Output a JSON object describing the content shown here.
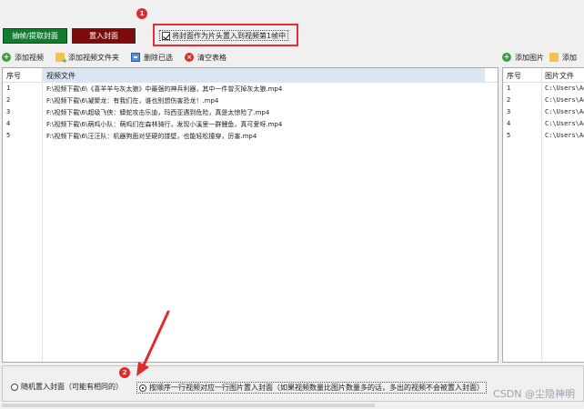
{
  "mode_buttons": {
    "extract_label": "抽帧/提取封面",
    "insert_label": "置入封面"
  },
  "annotations": {
    "badge_1": "1",
    "badge_2": "2"
  },
  "cover_option": {
    "label": "将封面作为片头置入到视频第1帧中",
    "checked": true
  },
  "left_toolbar": {
    "add_video": "添加视频",
    "add_video_folder": "添加视频文件夹",
    "delete_selected": "删除已选",
    "clear_table": "清空表格"
  },
  "right_toolbar": {
    "add_image": "添加图片",
    "add_cut": "添加"
  },
  "video_table": {
    "headers": [
      "序号",
      "视频文件"
    ],
    "rows": [
      {
        "idx": "1",
        "file": "F:\\视频下载\\6\\《喜羊羊与灰太狼》中最强的神兵利器，其中一件曾灭掉灰太狼.mp4"
      },
      {
        "idx": "2",
        "file": "F:\\视频下载\\6\\凝聚龙：有我们在，谁也别想伤害恐龙！.mp4"
      },
      {
        "idx": "3",
        "file": "F:\\视频下载\\6\\超级飞侠：蟒蛇攻击乐迪，玛西亚遇到危险，真是太惊险了.mp4"
      },
      {
        "idx": "4",
        "file": "F:\\视频下载\\6\\萌鸡小队：萌鸡们在森林骑行，发现小溪里一群鲤鱼，真可爱呀.mp4"
      },
      {
        "idx": "5",
        "file": "F:\\视频下载\\6\\汪汪队：机器狗面对坚硬的镂壁，也能轻松撞穿，厉害.mp4"
      }
    ]
  },
  "image_table": {
    "headers": [
      "序号",
      "图片文件"
    ],
    "rows": [
      {
        "idx": "1",
        "file": "C:\\Users\\Ad"
      },
      {
        "idx": "2",
        "file": "C:\\Users\\Ad"
      },
      {
        "idx": "3",
        "file": "C:\\Users\\Ad"
      },
      {
        "idx": "4",
        "file": "C:\\Users\\Ad"
      },
      {
        "idx": "5",
        "file": "C:\\Users\\Ad"
      }
    ]
  },
  "insert_mode": {
    "random_label": "随机置入封面（可能有相同的）",
    "order_label": "按顺序一行视频对应一行图片置入封面（如果视频数量比图片数量多的话，多出的视频不会被置入封面）",
    "selected": "order"
  },
  "watermark": "CSDN @尘隐神明",
  "colors": {
    "extract_button": "#0f7d2d",
    "insert_button": "#7d0b0b",
    "annotation_red": "#e02b2b",
    "header_highlight": "#dbe6f3"
  }
}
